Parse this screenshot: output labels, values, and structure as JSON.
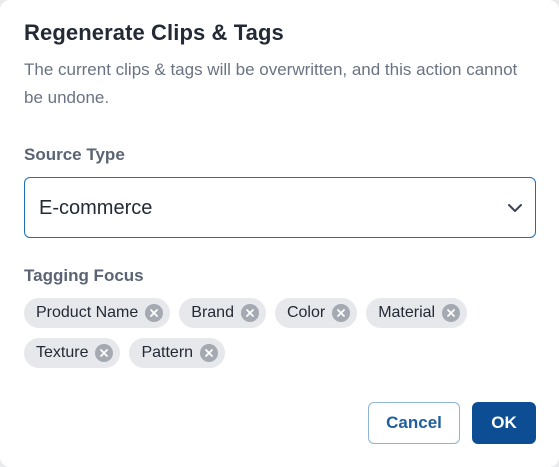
{
  "dialog": {
    "title": "Regenerate Clips & Tags",
    "description": "The current clips & tags will be overwritten, and this action cannot be undone."
  },
  "source_type": {
    "label": "Source Type",
    "selected": "E-commerce",
    "icon": "chevron-down-icon"
  },
  "tagging_focus": {
    "label": "Tagging Focus",
    "tags": [
      {
        "label": "Product Name"
      },
      {
        "label": "Brand"
      },
      {
        "label": "Color"
      },
      {
        "label": "Material"
      },
      {
        "label": "Texture"
      },
      {
        "label": "Pattern"
      }
    ],
    "remove_icon": "close-circle-icon"
  },
  "actions": {
    "cancel_label": "Cancel",
    "ok_label": "OK"
  },
  "colors": {
    "primary": "#0d4d94",
    "select_border": "#1f6fb5",
    "chip_background": "#e7e8eb"
  }
}
